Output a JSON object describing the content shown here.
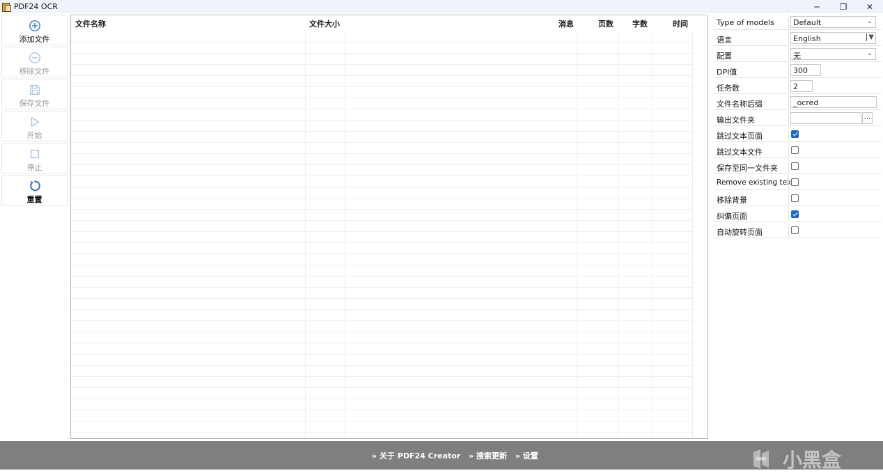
{
  "window": {
    "title": "PDF24 OCR",
    "minimize": "─",
    "restore": "❐",
    "close": "✕"
  },
  "toolbar": {
    "items": [
      {
        "label": "添加文件",
        "icon": "plus-circle-icon",
        "enabled": true
      },
      {
        "label": "移除文件",
        "icon": "minus-circle-icon",
        "enabled": false
      },
      {
        "label": "保存文件",
        "icon": "save-icon",
        "enabled": false
      },
      {
        "label": "开始",
        "icon": "play-icon",
        "enabled": false
      },
      {
        "label": "停止",
        "icon": "stop-icon",
        "enabled": false
      },
      {
        "label": "重置",
        "icon": "reset-icon",
        "enabled": true
      }
    ]
  },
  "table": {
    "columns": [
      "文件名称",
      "文件大小",
      "消息",
      "页数",
      "字数",
      "时间"
    ],
    "rows": []
  },
  "settings": {
    "model": {
      "label": "Type of models",
      "value": "Default"
    },
    "language": {
      "label": "语言",
      "value": "English"
    },
    "config": {
      "label": "配置",
      "value": "无"
    },
    "dpi": {
      "label": "DPI值",
      "value": "300"
    },
    "tasks": {
      "label": "任务数",
      "value": "2"
    },
    "suffix": {
      "label": "文件名称后缀",
      "value": "_ocred"
    },
    "output": {
      "label": "输出文件夹",
      "value": "",
      "browse": "..."
    },
    "skip_text_pages": {
      "label": "跳过文本页面",
      "checked": true
    },
    "skip_text_files": {
      "label": "跳过文本文件",
      "checked": false
    },
    "same_folder": {
      "label": "保存至同一文件夹",
      "checked": false
    },
    "remove_text": {
      "label": "Remove existing text",
      "checked": false
    },
    "remove_bg": {
      "label": "移除背景",
      "checked": false
    },
    "deskew": {
      "label": "纠偏页面",
      "checked": true
    },
    "auto_rotate": {
      "label": "自动旋转页面",
      "checked": false
    }
  },
  "footer": {
    "links": [
      "» 关于 PDF24 Creator",
      "» 搜索更新",
      "» 设置"
    ],
    "watermark": "小黑盒"
  },
  "colors": {
    "accent": "#1a67c7",
    "toolbar_icon": "#3a7bd5",
    "footer_bg": "#7f7f7f"
  }
}
